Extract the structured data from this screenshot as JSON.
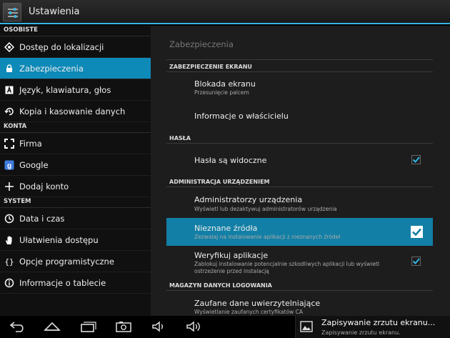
{
  "action_bar": {
    "title": "Ustawienia"
  },
  "left_panel": {
    "sections": [
      {
        "header": "OSOBISTE",
        "items": [
          {
            "label": "Dostęp do lokalizacji",
            "icon": "location-icon"
          },
          {
            "label": "Zabezpieczenia",
            "icon": "lock-icon",
            "selected": true
          },
          {
            "label": "Język, klawiatura, głos",
            "icon": "keyboard-icon"
          },
          {
            "label": "Kopia i kasowanie danych",
            "icon": "backup-icon"
          }
        ]
      },
      {
        "header": "KONTA",
        "items": [
          {
            "label": "Firma",
            "icon": "corporate-icon"
          },
          {
            "label": "Google",
            "icon": "google-icon"
          },
          {
            "label": "Dodaj konto",
            "icon": "add-icon"
          }
        ]
      },
      {
        "header": "SYSTEM",
        "items": [
          {
            "label": "Data i czas",
            "icon": "clock-icon"
          },
          {
            "label": "Ułatwienia dostępu",
            "icon": "hand-icon"
          },
          {
            "label": "Opcje programistyczne",
            "icon": "braces-icon"
          },
          {
            "label": "Informacje o tablecie",
            "icon": "info-icon"
          }
        ]
      }
    ]
  },
  "right_panel": {
    "title": "Zabezpieczenia",
    "sections": [
      {
        "header": "ZABEZPIECZENIE EKRANU",
        "rows": [
          {
            "title": "Blokada ekranu",
            "summary": "Przesunięcie palcem"
          },
          {
            "title": "Informacje o właścicielu"
          }
        ]
      },
      {
        "header": "HASŁA",
        "rows": [
          {
            "title": "Hasła są widoczne",
            "checked": true
          }
        ]
      },
      {
        "header": "ADMINISTRACJA URZĄDZENIEM",
        "rows": [
          {
            "title": "Administratorzy urządzenia",
            "summary": "Wyświetl lub dezaktywuj administratorów urządzenia"
          },
          {
            "title": "Nieznane źródła",
            "summary": "Zezwalaj na instalowanie aplikacji z nieznanych źródeł",
            "checked": true,
            "highlighted": true
          },
          {
            "title": "Weryfikuj aplikacje",
            "summary": "Zablokuj instalowanie potencjalnie szkodliwych aplikacji lub wyświetl ostrzeżenie przed instalacją",
            "checked": true
          }
        ]
      },
      {
        "header": "MAGAZYN DANYCH LOGOWANIA",
        "rows": [
          {
            "title": "Zaufane dane uwierzytelniające",
            "summary": "Wyświetlanie zaufanych certyfikatów CA"
          }
        ]
      }
    ]
  },
  "nav_bar": {
    "buttons": [
      "back-icon",
      "home-icon",
      "recents-icon",
      "screenshot-icon",
      "volume-down-icon",
      "volume-up-icon"
    ]
  },
  "notification": {
    "title": "Zapisywanie zrzutu ekranu...",
    "text": "Zapisywanie zrzutu ekranu."
  },
  "colors": {
    "accent": "#33b5e5",
    "selected": "#0e8ab8",
    "highlight": "#127fa6"
  }
}
